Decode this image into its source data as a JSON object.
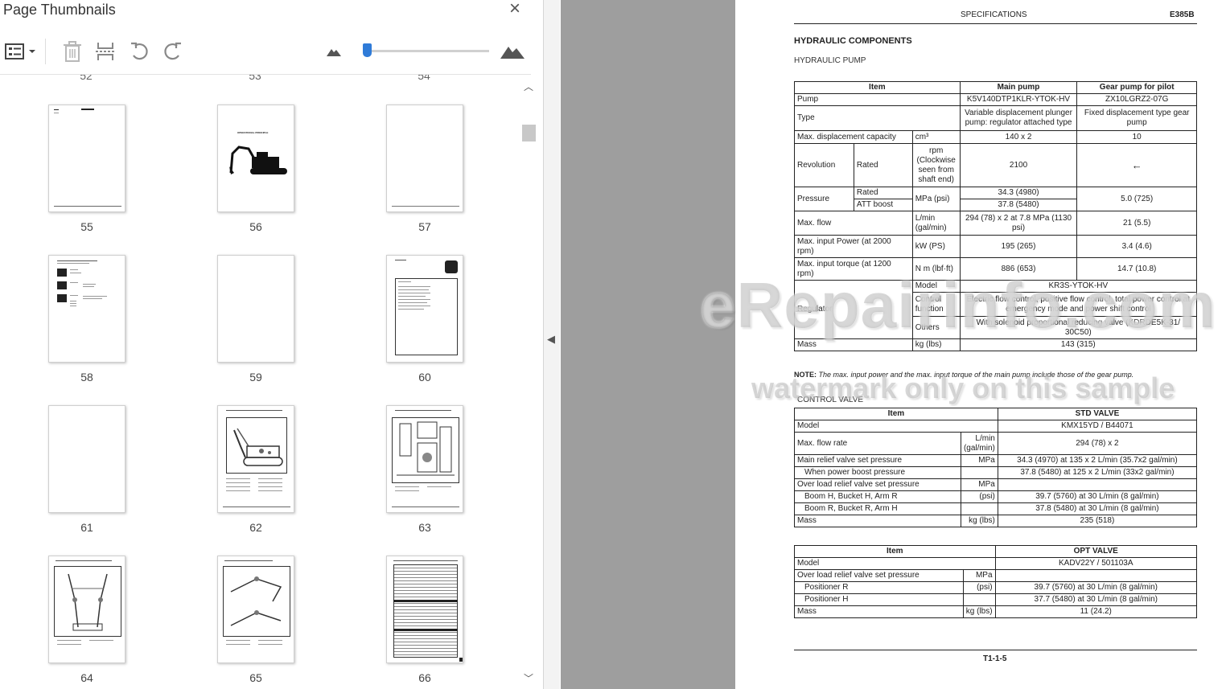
{
  "panel": {
    "title": "Page Thumbnails",
    "close_icon": "×"
  },
  "thumbnails": {
    "partial_labels": [
      "52",
      "53",
      "54"
    ],
    "pages": [
      "55",
      "56",
      "57",
      "58",
      "59",
      "60",
      "61",
      "62",
      "63",
      "64",
      "65",
      "66"
    ],
    "page56_caption": "OPERATIONAL PRINCIPLE"
  },
  "doc": {
    "header_left": "SPECIFICATIONS",
    "header_right": "E385B",
    "section_title": "HYDRAULIC COMPONENTS",
    "subsection_pump": "HYDRAULIC PUMP",
    "pump_table": {
      "col_item": "Item",
      "col_main": "Main pump",
      "col_gear": "Gear pump for pilot",
      "r_pump": [
        "Pump",
        "K5V140DTP1KLR-YTOK-HV",
        "ZX10LGRZ2-07G"
      ],
      "r_type": [
        "Type",
        "Variable displacement plunger pump: regulator attached type",
        "Fixed displacement type gear pump"
      ],
      "r_disp": [
        "Max. displacement capacity",
        "cm³",
        "140 x 2",
        "10"
      ],
      "r_rev": [
        "Revolution",
        "Rated",
        "rpm (Clockwise seen from shaft end)",
        "2100",
        "←"
      ],
      "r_press_label": "Pressure",
      "r_press_rated": [
        "Rated",
        "34.3 (4980)"
      ],
      "r_press_att": [
        "ATT boost",
        "37.8 (5480)"
      ],
      "r_press_unit": "MPa (psi)",
      "r_press_gear": "5.0 (725)",
      "r_flow": [
        "Max. flow",
        "L/min (gal/min)",
        "294 (78) x 2 at 7.8 MPa (1130 psi)",
        "21 (5.5)"
      ],
      "r_power": [
        "Max. input Power (at 2000 rpm)",
        "kW (PS)",
        "195 (265)",
        "3.4 (4.6)"
      ],
      "r_torque": [
        "Max. input torque (at 1200 rpm)",
        "N m (lbf·ft)",
        "886 (653)",
        "14.7 (10.8)"
      ],
      "r_reg_label": "Regulator",
      "r_reg_model": [
        "Model",
        "KR3S-YTOK-HV"
      ],
      "r_reg_ctrl": [
        "Control function",
        "Electric flow control, positive flow control, total power control at emergency mode and power shift control"
      ],
      "r_reg_others": [
        "Others",
        "With solenoid proportional reducing valve (KDRDE5K-31/ 30C50)"
      ],
      "r_mass": [
        "Mass",
        "kg (lbs)",
        "143 (315)"
      ]
    },
    "note_label": "NOTE:",
    "note_text": "The max. input power and the max. input torque of the main pump include those of the gear pump.",
    "subsection_valve": "CONTROL VALVE",
    "std_table": {
      "col_item": "Item",
      "col_val": "STD VALVE",
      "model": [
        "Model",
        "KMX15YD / B44071"
      ],
      "flow": [
        "Max. flow rate",
        "L/min (gal/min)",
        "294 (78) x 2"
      ],
      "relief": [
        "Main relief valve set pressure",
        "MPa",
        "34.3 (4970) at 135 x 2 L/min (35.7x2 gal/min)"
      ],
      "boost": [
        "When power boost pressure",
        "37.8 (5480) at 125 x 2 L/min (33x2 gal/min)"
      ],
      "overload": [
        "Over load relief valve set pressure",
        "MPa"
      ],
      "ol1": [
        "Boom H, Bucket H, Arm R",
        "(psi)",
        "39.7 (5760) at 30 L/min (8 gal/min)"
      ],
      "ol2": [
        "Boom R, Bucket R, Arm H",
        "37.8 (5480) at 30 L/min (8 gal/min)"
      ],
      "mass": [
        "Mass",
        "kg (lbs)",
        "235 (518)"
      ]
    },
    "opt_table": {
      "col_item": "Item",
      "col_val": "OPT VALVE",
      "model": [
        "Model",
        "KADV22Y / 501103A"
      ],
      "overload": [
        "Over load relief valve set pressure",
        "MPa"
      ],
      "pr": [
        "Positioner R",
        "(psi)",
        "39.7 (5760) at 30 L/min (8 gal/min)"
      ],
      "ph": [
        "Positioner H",
        "37.7 (5480) at 30 L/min (8 gal/min)"
      ],
      "mass": [
        "Mass",
        "kg (lbs)",
        "11 (24.2)"
      ]
    },
    "footer_page": "T1-1-5",
    "watermark_1": "eRepairinfo.com",
    "watermark_2": "watermark only on this sample"
  }
}
